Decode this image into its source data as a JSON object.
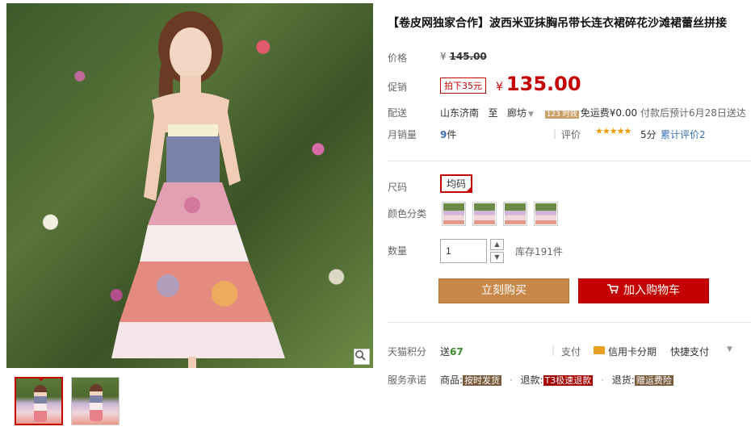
{
  "product": {
    "title": "【卷皮网独家合作】波西米亚抹胸吊带长连衣裙碎花沙滩裙蕾丝拼接"
  },
  "price": {
    "label": "价格",
    "currency": "¥",
    "original": "145.00"
  },
  "promotion": {
    "label": "促销",
    "tag": "拍下35元",
    "currency": "¥",
    "price": "135.00"
  },
  "shipping": {
    "label": "配送",
    "from": "山东济南",
    "to_word": "至",
    "to": "廊坊",
    "badge": "123 时效",
    "fee": "免运费¥0.00",
    "note": "付款后预计6月28日送达"
  },
  "sales": {
    "label": "月销量",
    "count": "9",
    "unit": "件",
    "review_label": "评价",
    "stars": "★★★★★",
    "score": "5分",
    "review_count": "累计评价2"
  },
  "size": {
    "label": "尺码",
    "option": "均码"
  },
  "color": {
    "label": "颜色分类",
    "options": [
      "color-1",
      "color-2",
      "color-3",
      "color-4"
    ]
  },
  "quantity": {
    "label": "数量",
    "value": "1",
    "stock": "库存191件"
  },
  "buttons": {
    "buy_now": "立刻购买",
    "add_cart": "加入购物车"
  },
  "points": {
    "label": "天猫积分",
    "text": "送",
    "value": "67"
  },
  "payment": {
    "label": "支付",
    "credit": "信用卡分期",
    "quick": "快捷支付"
  },
  "service": {
    "label": "服务承诺",
    "item1_label": "商品:",
    "item1_tag": "按时发货",
    "item2_label": "退款:",
    "item2_tag": "T3极速退款",
    "item3_label": "退货:",
    "item3_tag": "赠运费险"
  },
  "icons": {
    "zoom": "magnifier-icon",
    "cart": "cart-icon",
    "card": "credit-card-icon"
  }
}
